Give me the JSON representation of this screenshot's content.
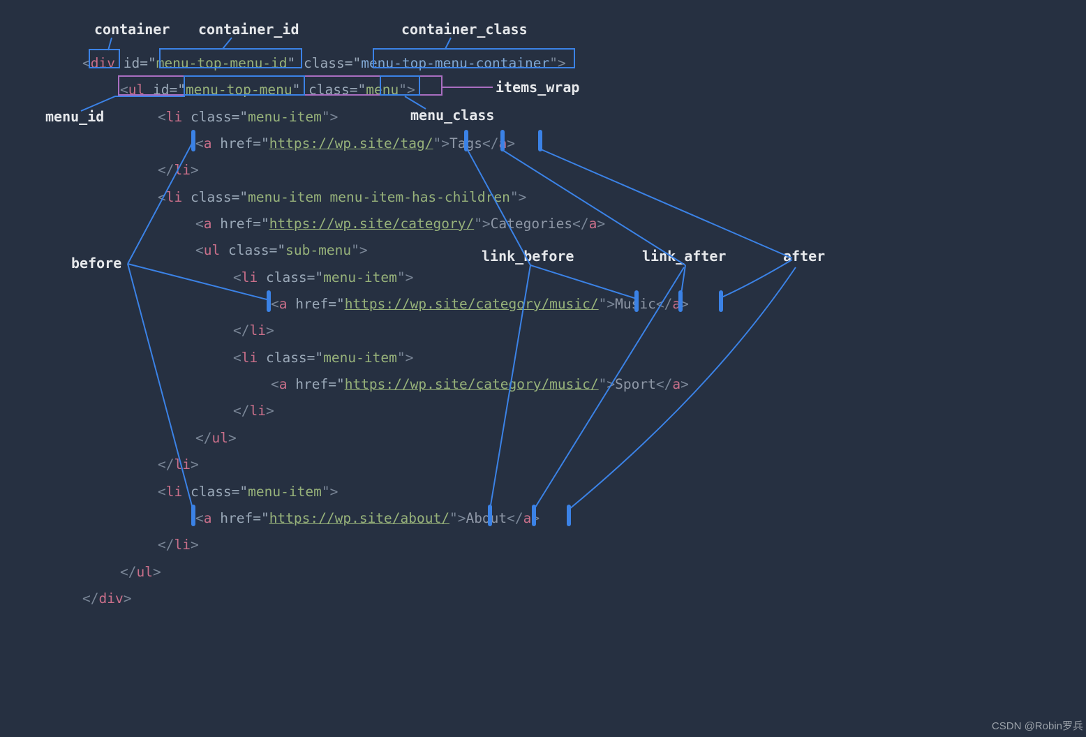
{
  "labels": {
    "container": "container",
    "container_id": "container_id",
    "container_class": "container_class",
    "menu_id": "menu_id",
    "items_wrap": "items_wrap",
    "menu_class": "menu_class",
    "before": "before",
    "link_before": "link_before",
    "link_after": "link_after",
    "after": "after"
  },
  "code": {
    "div_tag": "div",
    "div_id_attr": " id=\"",
    "div_id_val": "menu-top-menu-id",
    "div_class_attr": "\" class=\"",
    "div_class_val": "menu-top-menu-container",
    "close_attr": "\">",
    "ul_open_punc": "<",
    "ul_tag": "ul",
    "ul_id_attr": " id=\"",
    "ul_id_val": "menu-top-menu",
    "ul_class_attr": "\" class=\"",
    "ul_class_val": "menu",
    "li_open": "<li class=\"menu-item\">",
    "a_open": "<a href=\"",
    "href_tags": "https://wp.site/tag/",
    "href_cat": "https://wp.site/category/",
    "href_music": "https://wp.site/category/music/",
    "href_about": "https://wp.site/about/",
    "a_mid": "\">",
    "tags_text": "Tags",
    "cat_text": "Categories",
    "music_text": "Music",
    "sport_text": "Sport",
    "about_text": "About",
    "a_close": "</a>",
    "li_close": "</li>",
    "li_children": "<li class=\"menu-item menu-item-has-children\">",
    "ul_sub": "<ul class=\"sub-menu\">",
    "ul_close": "</ul>",
    "div_close": "</div>"
  },
  "watermark": "CSDN @Robin罗兵"
}
